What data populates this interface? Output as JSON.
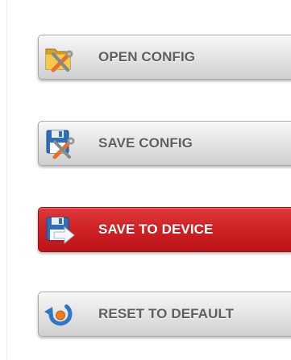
{
  "buttons": {
    "open_config": {
      "label": "OPEN CONFIG",
      "icon": "folder-tools-icon"
    },
    "save_config": {
      "label": "SAVE CONFIG",
      "icon": "disk-tools-icon"
    },
    "save_to_device": {
      "label": "SAVE TO DEVICE",
      "icon": "disk-arrow-icon"
    },
    "reset_to_default": {
      "label": "RESET TO DEFAULT",
      "icon": "reset-icon"
    }
  },
  "colors": {
    "grey_button": "#e2e2e2",
    "grey_text": "#5e5e5e",
    "red_button": "#cf2124",
    "red_text": "#ffffff"
  }
}
